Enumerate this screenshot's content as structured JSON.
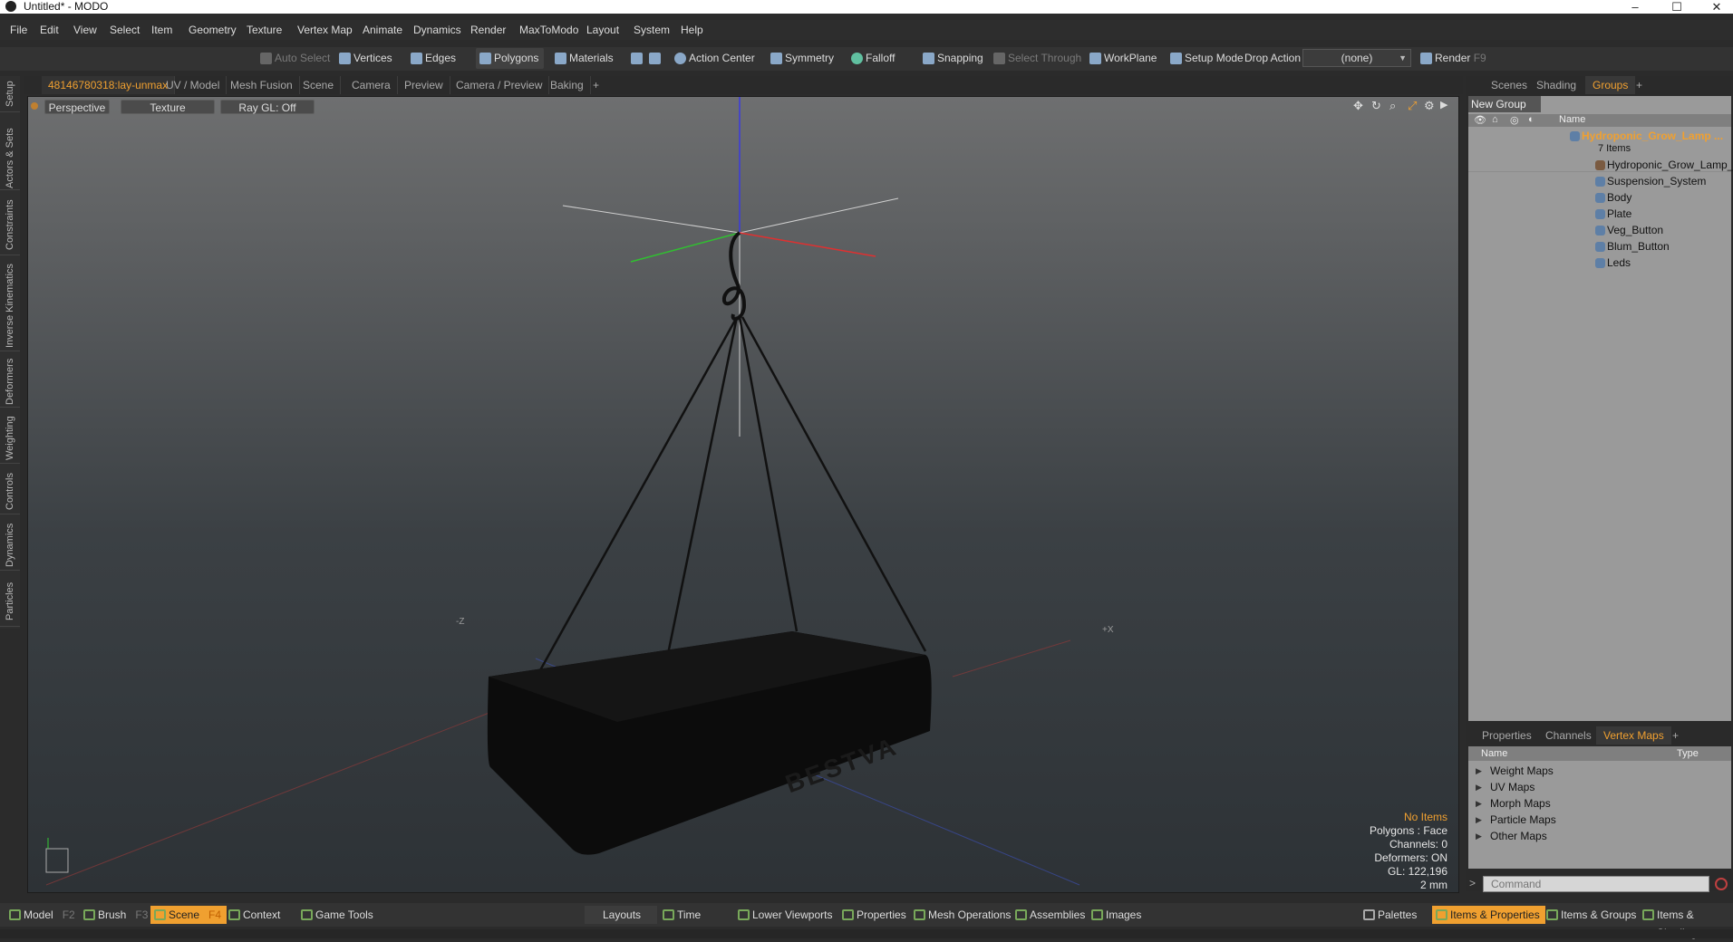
{
  "window": {
    "title": "Untitled* - MODO",
    "controls": [
      "–",
      "☐",
      "✕"
    ]
  },
  "menu": [
    "File",
    "Edit",
    "View",
    "Select",
    "Item",
    "Geometry",
    "Texture",
    "Vertex Map",
    "Animate",
    "Dynamics",
    "Render",
    "MaxToModo",
    "Layout",
    "System",
    "Help"
  ],
  "toolbar": {
    "auto_select": "Auto Select",
    "vertices": "Vertices",
    "edges": "Edges",
    "polygons": "Polygons",
    "materials": "Materials",
    "action_center": "Action Center",
    "symmetry": "Symmetry",
    "falloff": "Falloff",
    "snapping": "Snapping",
    "select_through": "Select Through",
    "workplane": "WorkPlane",
    "setup_mode": "Setup Mode",
    "drop_action": "Drop Action",
    "drop_value": "(none)",
    "render": "Render",
    "render_key": "F9"
  },
  "left_tabs": [
    "Setup",
    "Actors & Sets",
    "Constraints",
    "Inverse Kinematics",
    "Deformers",
    "Weighting",
    "Controls",
    "Dynamics",
    "Particles"
  ],
  "viewport_tabs": [
    "48146780318:lay-unmax",
    "UV / Model",
    "Mesh Fusion",
    "Scene",
    "Camera",
    "Preview",
    "Camera / Preview",
    "Baking",
    "+"
  ],
  "viewport": {
    "view_mode": "Perspective",
    "shading": "Texture",
    "raygl": "Ray GL: Off",
    "brand": "BESTVA",
    "axis_z": "-Z",
    "axis_x": "+X",
    "info": {
      "selection": "No Items",
      "polygons": "Polygons : Face",
      "channels": "Channels: 0",
      "deformers": "Deformers: ON",
      "gl": "GL: 122,196",
      "units": "2 mm"
    }
  },
  "right_tabs": [
    "Scenes",
    "Shading",
    "Groups",
    "+"
  ],
  "groups": {
    "new_group": "New Group",
    "col_name": "Name",
    "root": "Hydroponic_Grow_Lamp ...",
    "count": "7 Items",
    "items": [
      "Hydroponic_Grow_Lamp_B ...",
      "Suspension_System",
      "Body",
      "Plate",
      "Veg_Button",
      "Blum_Button",
      "Leds"
    ]
  },
  "lower_tabs": [
    "Properties",
    "Channels",
    "Vertex Maps",
    "+"
  ],
  "vertex_maps": {
    "col_name": "Name",
    "col_type": "Type",
    "items": [
      "Weight Maps",
      "UV Maps",
      "Morph Maps",
      "Particle Maps",
      "Other Maps"
    ]
  },
  "command_placeholder": "Command",
  "bottom": {
    "model": "Model",
    "model_key": "F2",
    "brush": "Brush",
    "brush_key": "F3",
    "scene": "Scene",
    "scene_key": "F4",
    "context": "Context",
    "game_tools": "Game Tools",
    "layouts": "Layouts",
    "time": "Time",
    "lower_viewports": "Lower Viewports",
    "properties": "Properties",
    "mesh_operations": "Mesh Operations",
    "assemblies": "Assemblies",
    "images": "Images",
    "palettes": "Palettes",
    "items_properties": "Items & Properties",
    "items_groups": "Items & Groups",
    "items_shading": "Items & Shading"
  },
  "colors": {
    "accent": "#f0a030",
    "background": "#2b2b2b",
    "panel": "#9a9a9a"
  }
}
